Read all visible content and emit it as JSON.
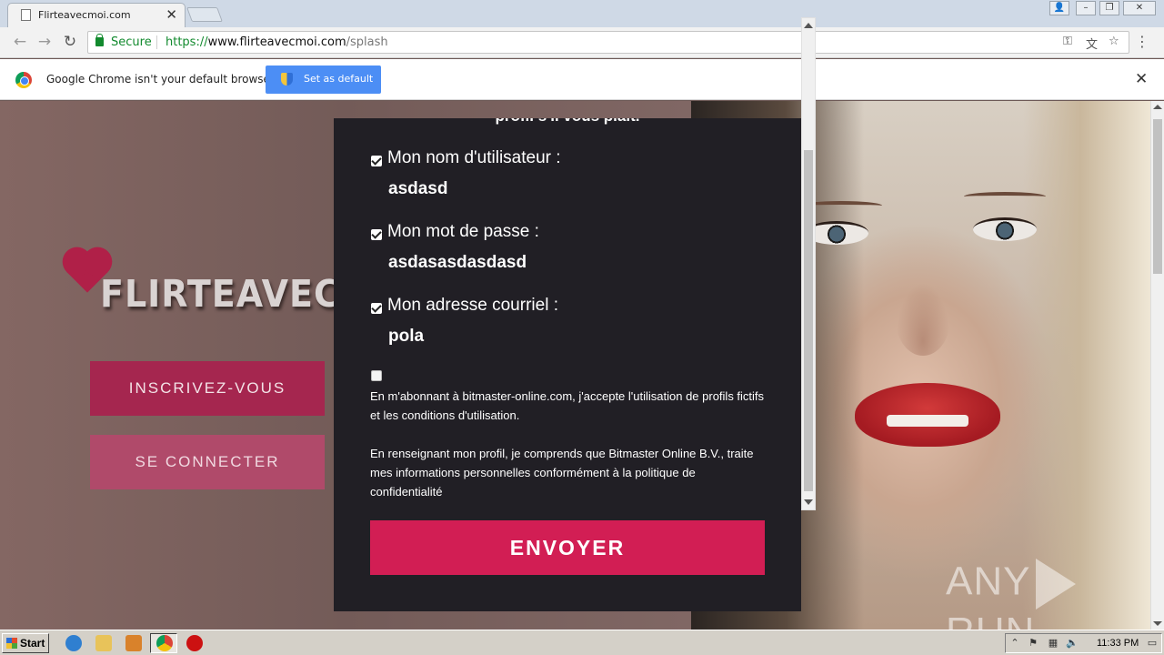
{
  "browser": {
    "tab_title": "Flirteavecmoi.com",
    "omnibox": {
      "secure_label": "Secure",
      "url_scheme": "https://",
      "url_host": "www.flirteavecmoi.com",
      "url_path": "/splash"
    },
    "infobar": {
      "message": "Google Chrome isn't your default browser",
      "button_label": "Set as default"
    }
  },
  "site": {
    "logo_text": "FLIRTEAVECMOI",
    "signup_label": "INSCRIVEZ-VOUS",
    "login_label": "SE CONNECTER"
  },
  "modal": {
    "heading": "profil s'il vous plaît.",
    "fields": [
      {
        "label": "Mon nom d'utilisateur :",
        "value": "asdasd",
        "checked": true
      },
      {
        "label": "Mon mot de passe :",
        "value": "asdasasdasdasd",
        "checked": true
      },
      {
        "label": "Mon adresse courriel :",
        "value": "pola",
        "checked": true
      }
    ],
    "terms_checked": false,
    "terms_text": "En m'abonnant à bitmaster-online.com, j'accepte l'utilisation de profils fictifs et les conditions d'utilisation.",
    "privacy_text": "En renseignant mon profil, je comprends que Bitmaster Online B.V., traite mes informations personnelles conformément à la politique de confidentialité",
    "submit_label": "ENVOYER"
  },
  "watermark": {
    "left": "ANY",
    "right": "RUN"
  },
  "taskbar": {
    "start_label": "Start",
    "clock": "11:33 PM"
  }
}
